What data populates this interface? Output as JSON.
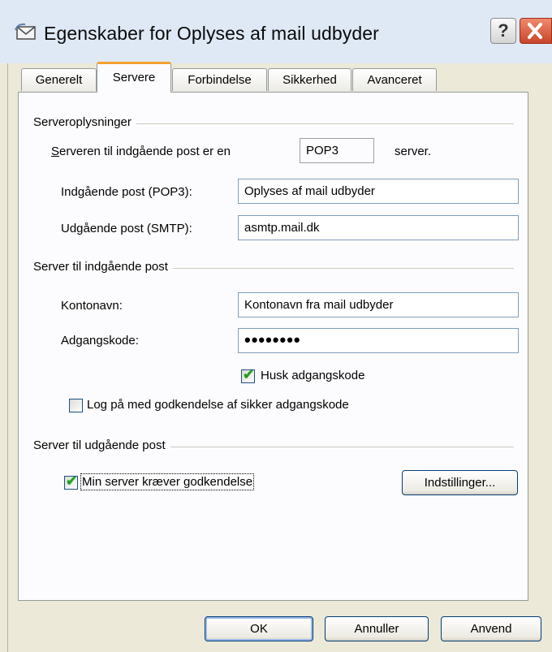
{
  "window": {
    "title": "Egenskaber for Oplyses af mail udbyder",
    "help_label": "?",
    "close_label": "✕"
  },
  "tabs": [
    "Generelt",
    "Servere",
    "Forbindelse",
    "Sikkerhed",
    "Avanceret"
  ],
  "active_tab": "Servere",
  "server_info": {
    "group_label": "Serveroplysninger",
    "type_label_prefix": "Serveren til indgående post er en",
    "server_type": "POP3",
    "type_label_suffix": "server.",
    "incoming_label": "Indgående post (POP3):",
    "incoming_value": "Oplyses af mail udbyder",
    "outgoing_label": "Udgående post (SMTP):",
    "outgoing_value": "asmtp.mail.dk"
  },
  "incoming_server": {
    "group_label": "Server til indgående post",
    "account_label": "Kontonavn:",
    "account_value": "Kontonavn fra mail udbyder",
    "password_label": "Adgangskode:",
    "password_value": "••••••••",
    "remember_label": "Husk adgangskode",
    "remember_checked": true,
    "spa_label": "Log på med godkendelse af sikker adgangskode",
    "spa_checked": false
  },
  "outgoing_server": {
    "group_label": "Server til udgående post",
    "auth_label": "Min server kræver godkendelse",
    "auth_checked": true,
    "settings_button": "Indstillinger..."
  },
  "footer": {
    "ok": "OK",
    "cancel": "Annuller",
    "apply": "Anvend"
  }
}
